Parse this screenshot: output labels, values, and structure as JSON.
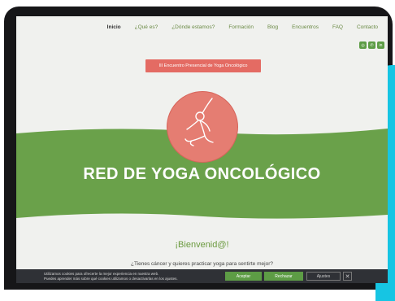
{
  "nav": {
    "items": [
      {
        "label": "Inicio",
        "active": true
      },
      {
        "label": "¿Qué es?"
      },
      {
        "label": "¿Dónde estamos?"
      },
      {
        "label": "Formación"
      },
      {
        "label": "Blog"
      },
      {
        "label": "Encuentros"
      },
      {
        "label": "FAQ"
      },
      {
        "label": "Contacto"
      }
    ]
  },
  "social": {
    "icons": [
      "instagram-icon",
      "whatsapp-icon",
      "linkedin-icon"
    ],
    "glyphs": [
      "◎",
      "✆",
      "in"
    ]
  },
  "event_button": {
    "label": "III Encuentro Presencial de Yoga Oncológico"
  },
  "hero": {
    "title": "RED DE YOGA ONCOLÓGICO"
  },
  "welcome": {
    "title": "¡Bienvenid@!"
  },
  "intro": {
    "question": "¿Tienes cáncer y quieres practicar yoga para sentirte mejor?"
  },
  "cookie": {
    "line1": "Utilizamos cookies para ofrecerte la mejor experiencia en nuestra web.",
    "line2": "Puedes aprender más sobre qué cookies utilizamos o desactivarlas en los ajustes.",
    "accept": "Aceptar",
    "reject": "Rechazar",
    "settings": "Ajustes",
    "close": "✕"
  },
  "colors": {
    "accent_green": "#6b9a3f",
    "coral": "#e46b63",
    "band_green": "#6aa14a",
    "cyan_edge": "#16c5e3"
  }
}
